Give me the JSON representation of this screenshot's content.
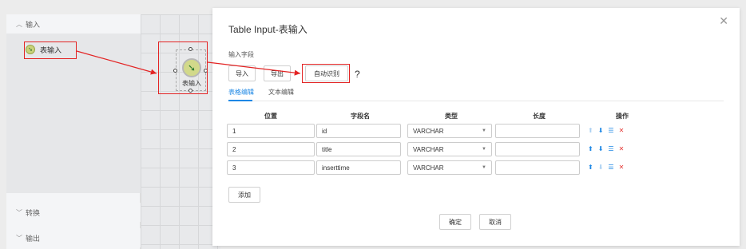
{
  "sidebar": {
    "groups": [
      {
        "label": "输入",
        "expanded": true,
        "items": [
          {
            "label": "表输入"
          }
        ]
      },
      {
        "label": "转换",
        "expanded": false
      },
      {
        "label": "输出",
        "expanded": false
      }
    ]
  },
  "canvas": {
    "node_label": "表输入"
  },
  "modal": {
    "title": "Table Input-表输入",
    "section_label": "输入字段",
    "buttons": {
      "import": "导入",
      "export": "导出",
      "auto_detect": "自动识别",
      "help": "?"
    },
    "tabs": [
      {
        "label": "表格编辑",
        "active": true
      },
      {
        "label": "文本编辑",
        "active": false
      }
    ],
    "columns": [
      "位置",
      "字段名",
      "类型",
      "长度",
      "操作"
    ],
    "rows": [
      {
        "position": "1",
        "name": "id",
        "type": "VARCHAR",
        "length": ""
      },
      {
        "position": "2",
        "name": "title",
        "type": "VARCHAR",
        "length": ""
      },
      {
        "position": "3",
        "name": "inserttime",
        "type": "VARCHAR",
        "length": ""
      }
    ],
    "add_label": "添加",
    "confirm_label": "确定",
    "cancel_label": "取消"
  },
  "colors": {
    "accent": "#1e88e5",
    "annotation_red": "#e32424",
    "delete_red": "#e53935"
  },
  "icons": {
    "up": "arrow-up-icon",
    "down": "arrow-down-icon",
    "insert": "insert-row-icon",
    "delete": "delete-icon",
    "close": "close-icon"
  }
}
